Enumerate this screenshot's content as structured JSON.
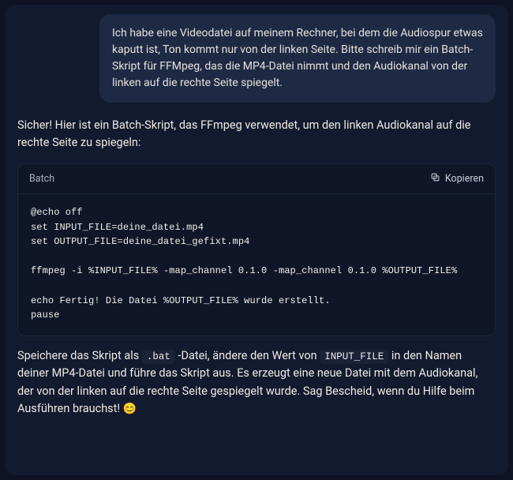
{
  "user": {
    "message": "Ich habe eine Videodatei auf meinem Rechner, bei dem die Audiospur etwas kaputt ist, Ton kommt nur von der linken Seite. Bitte schreib mir ein Batch-Skript für FFMpeg, das die MP4-Datei nimmt und den Audiokanal von der linken auf die rechte Seite spiegelt."
  },
  "assistant": {
    "intro": "Sicher! Hier ist ein Batch-Skript, das FFmpeg verwendet, um den linken Audiokanal auf die rechte Seite zu spiegeln:",
    "code_block": {
      "language_label": "Batch",
      "copy_label": "Kopieren",
      "code": "@echo off\nset INPUT_FILE=deine_datei.mp4\nset OUTPUT_FILE=deine_datei_gefixt.mp4\n\nffmpeg -i %INPUT_FILE% -map_channel 0.1.0 -map_channel 0.1.0 %OUTPUT_FILE%\n\necho Fertig! Die Datei %OUTPUT_FILE% wurde erstellt.\npause"
    },
    "outro_parts": {
      "p1": "Speichere das Skript als ",
      "c1": ".bat",
      "p2": " -Datei, ändere den Wert von ",
      "c2": "INPUT_FILE",
      "p3": " in den Namen deiner MP4-Datei und führe das Skript aus. Es erzeugt eine neue Datei mit dem Audiokanal, der von der linken auf die rechte Seite gespiegelt wurde. Sag Bescheid, wenn du Hilfe beim Ausführen brauchst! ",
      "emoji": "😊"
    }
  }
}
